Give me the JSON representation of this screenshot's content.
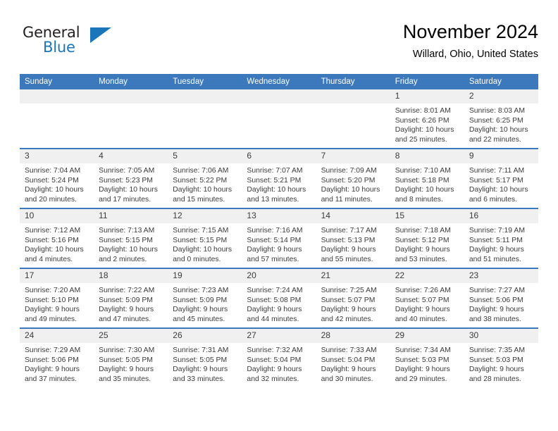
{
  "brand": {
    "name_part1": "General",
    "name_part2": "Blue",
    "logo_icon": "triangle-logo-icon"
  },
  "header": {
    "title": "November 2024",
    "subtitle": "Willard, Ohio, United States"
  },
  "colors": {
    "header_blue": "#3c78bc",
    "brand_blue": "#1b75bb",
    "daynum_band": "#f0f0f0",
    "text": "#3b3b3b"
  },
  "weekday_headers": [
    "Sunday",
    "Monday",
    "Tuesday",
    "Wednesday",
    "Thursday",
    "Friday",
    "Saturday"
  ],
  "weeks": [
    [
      {
        "day": "",
        "blank": true
      },
      {
        "day": "",
        "blank": true
      },
      {
        "day": "",
        "blank": true
      },
      {
        "day": "",
        "blank": true
      },
      {
        "day": "",
        "blank": true
      },
      {
        "day": "1",
        "sunrise": "Sunrise: 8:01 AM",
        "sunset": "Sunset: 6:26 PM",
        "daylight": "Daylight: 10 hours and 25 minutes."
      },
      {
        "day": "2",
        "sunrise": "Sunrise: 8:03 AM",
        "sunset": "Sunset: 6:25 PM",
        "daylight": "Daylight: 10 hours and 22 minutes."
      }
    ],
    [
      {
        "day": "3",
        "sunrise": "Sunrise: 7:04 AM",
        "sunset": "Sunset: 5:24 PM",
        "daylight": "Daylight: 10 hours and 20 minutes."
      },
      {
        "day": "4",
        "sunrise": "Sunrise: 7:05 AM",
        "sunset": "Sunset: 5:23 PM",
        "daylight": "Daylight: 10 hours and 17 minutes."
      },
      {
        "day": "5",
        "sunrise": "Sunrise: 7:06 AM",
        "sunset": "Sunset: 5:22 PM",
        "daylight": "Daylight: 10 hours and 15 minutes."
      },
      {
        "day": "6",
        "sunrise": "Sunrise: 7:07 AM",
        "sunset": "Sunset: 5:21 PM",
        "daylight": "Daylight: 10 hours and 13 minutes."
      },
      {
        "day": "7",
        "sunrise": "Sunrise: 7:09 AM",
        "sunset": "Sunset: 5:20 PM",
        "daylight": "Daylight: 10 hours and 11 minutes."
      },
      {
        "day": "8",
        "sunrise": "Sunrise: 7:10 AM",
        "sunset": "Sunset: 5:18 PM",
        "daylight": "Daylight: 10 hours and 8 minutes."
      },
      {
        "day": "9",
        "sunrise": "Sunrise: 7:11 AM",
        "sunset": "Sunset: 5:17 PM",
        "daylight": "Daylight: 10 hours and 6 minutes."
      }
    ],
    [
      {
        "day": "10",
        "sunrise": "Sunrise: 7:12 AM",
        "sunset": "Sunset: 5:16 PM",
        "daylight": "Daylight: 10 hours and 4 minutes."
      },
      {
        "day": "11",
        "sunrise": "Sunrise: 7:13 AM",
        "sunset": "Sunset: 5:15 PM",
        "daylight": "Daylight: 10 hours and 2 minutes."
      },
      {
        "day": "12",
        "sunrise": "Sunrise: 7:15 AM",
        "sunset": "Sunset: 5:15 PM",
        "daylight": "Daylight: 10 hours and 0 minutes."
      },
      {
        "day": "13",
        "sunrise": "Sunrise: 7:16 AM",
        "sunset": "Sunset: 5:14 PM",
        "daylight": "Daylight: 9 hours and 57 minutes."
      },
      {
        "day": "14",
        "sunrise": "Sunrise: 7:17 AM",
        "sunset": "Sunset: 5:13 PM",
        "daylight": "Daylight: 9 hours and 55 minutes."
      },
      {
        "day": "15",
        "sunrise": "Sunrise: 7:18 AM",
        "sunset": "Sunset: 5:12 PM",
        "daylight": "Daylight: 9 hours and 53 minutes."
      },
      {
        "day": "16",
        "sunrise": "Sunrise: 7:19 AM",
        "sunset": "Sunset: 5:11 PM",
        "daylight": "Daylight: 9 hours and 51 minutes."
      }
    ],
    [
      {
        "day": "17",
        "sunrise": "Sunrise: 7:20 AM",
        "sunset": "Sunset: 5:10 PM",
        "daylight": "Daylight: 9 hours and 49 minutes."
      },
      {
        "day": "18",
        "sunrise": "Sunrise: 7:22 AM",
        "sunset": "Sunset: 5:09 PM",
        "daylight": "Daylight: 9 hours and 47 minutes."
      },
      {
        "day": "19",
        "sunrise": "Sunrise: 7:23 AM",
        "sunset": "Sunset: 5:09 PM",
        "daylight": "Daylight: 9 hours and 45 minutes."
      },
      {
        "day": "20",
        "sunrise": "Sunrise: 7:24 AM",
        "sunset": "Sunset: 5:08 PM",
        "daylight": "Daylight: 9 hours and 44 minutes."
      },
      {
        "day": "21",
        "sunrise": "Sunrise: 7:25 AM",
        "sunset": "Sunset: 5:07 PM",
        "daylight": "Daylight: 9 hours and 42 minutes."
      },
      {
        "day": "22",
        "sunrise": "Sunrise: 7:26 AM",
        "sunset": "Sunset: 5:07 PM",
        "daylight": "Daylight: 9 hours and 40 minutes."
      },
      {
        "day": "23",
        "sunrise": "Sunrise: 7:27 AM",
        "sunset": "Sunset: 5:06 PM",
        "daylight": "Daylight: 9 hours and 38 minutes."
      }
    ],
    [
      {
        "day": "24",
        "sunrise": "Sunrise: 7:29 AM",
        "sunset": "Sunset: 5:06 PM",
        "daylight": "Daylight: 9 hours and 37 minutes."
      },
      {
        "day": "25",
        "sunrise": "Sunrise: 7:30 AM",
        "sunset": "Sunset: 5:05 PM",
        "daylight": "Daylight: 9 hours and 35 minutes."
      },
      {
        "day": "26",
        "sunrise": "Sunrise: 7:31 AM",
        "sunset": "Sunset: 5:05 PM",
        "daylight": "Daylight: 9 hours and 33 minutes."
      },
      {
        "day": "27",
        "sunrise": "Sunrise: 7:32 AM",
        "sunset": "Sunset: 5:04 PM",
        "daylight": "Daylight: 9 hours and 32 minutes."
      },
      {
        "day": "28",
        "sunrise": "Sunrise: 7:33 AM",
        "sunset": "Sunset: 5:04 PM",
        "daylight": "Daylight: 9 hours and 30 minutes."
      },
      {
        "day": "29",
        "sunrise": "Sunrise: 7:34 AM",
        "sunset": "Sunset: 5:03 PM",
        "daylight": "Daylight: 9 hours and 29 minutes."
      },
      {
        "day": "30",
        "sunrise": "Sunrise: 7:35 AM",
        "sunset": "Sunset: 5:03 PM",
        "daylight": "Daylight: 9 hours and 28 minutes."
      }
    ]
  ]
}
